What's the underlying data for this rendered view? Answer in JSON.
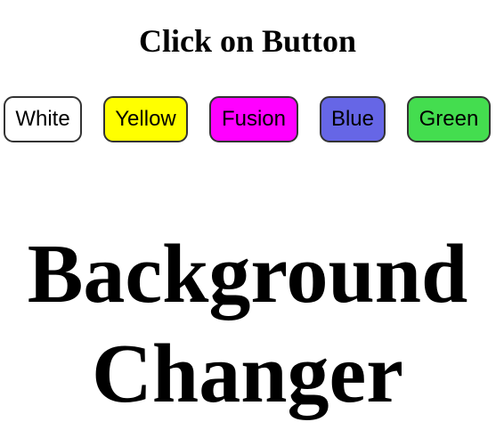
{
  "header": {
    "subtitle": "Click on Button"
  },
  "buttons": [
    {
      "label": "White",
      "color": "#ffffff"
    },
    {
      "label": "Yellow",
      "color": "#ffff00"
    },
    {
      "label": "Fusion",
      "color": "#ff00ff"
    },
    {
      "label": "Blue",
      "color": "#6666e6"
    },
    {
      "label": "Green",
      "color": "#44dd4f"
    }
  ],
  "main": {
    "title_line1": "Background",
    "title_line2": "Changer"
  }
}
